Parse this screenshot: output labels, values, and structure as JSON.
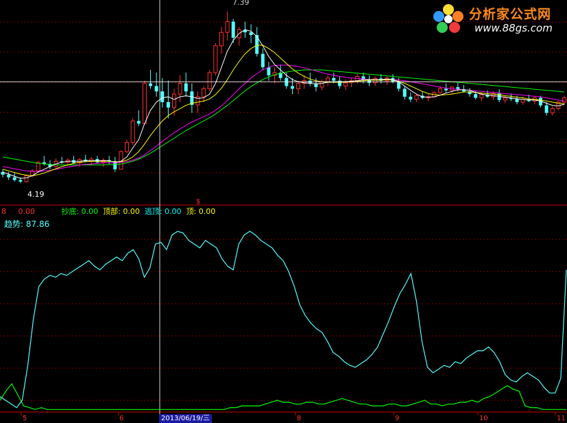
{
  "logo": {
    "title": "分析家公式网",
    "url": "www.88gs.com"
  },
  "price_panel": {
    "high_label": "7.39",
    "low_label": "4.19",
    "indicator_line": [
      {
        "text": "8",
        "color": "#ff3030"
      },
      {
        "text": "0.00",
        "color": "#ff3030"
      },
      {
        "text": "抄底: 0.00",
        "color": "#00ff00"
      },
      {
        "text": "顶部: 0.00",
        "color": "#ffff00"
      },
      {
        "text": "逃顶: 0.00",
        "color": "#00ffff"
      },
      {
        "text": "顶: 0.00",
        "color": "#ffff00"
      }
    ]
  },
  "indicator_panel": {
    "title": "趋势: 87.86"
  },
  "time_axis": {
    "ticks": [
      "5",
      "6",
      "8",
      "9",
      "10",
      "11"
    ],
    "cursor_date": "2013/06/19/三"
  },
  "colors": {
    "background": "#000000",
    "up_candle": "#ff3030",
    "down_candle": "#54ffff",
    "ma_short": "#ffffff",
    "ma_mid": "#ffff00",
    "ma_long": "#ff00ff",
    "ma_longest": "#00ff00",
    "trend_line": "#54ffff",
    "secondary_line": "#00ff00",
    "grid": "#7a0000"
  },
  "chart_data": [
    {
      "type": "candlestick",
      "title": "",
      "ylim": [
        3.9,
        7.5
      ],
      "price_levels": {
        "high": 7.39,
        "low": 4.19,
        "crosshair": 6.08
      },
      "candles_ohlc": [
        [
          4.4,
          4.45,
          4.3,
          4.35
        ],
        [
          4.35,
          4.4,
          4.25,
          4.3
        ],
        [
          4.3,
          4.38,
          4.22,
          4.25
        ],
        [
          4.25,
          4.3,
          4.19,
          4.22
        ],
        [
          4.22,
          4.35,
          4.2,
          4.33
        ],
        [
          4.33,
          4.45,
          4.3,
          4.42
        ],
        [
          4.42,
          4.6,
          4.4,
          4.58
        ],
        [
          4.58,
          4.7,
          4.52,
          4.55
        ],
        [
          4.55,
          4.62,
          4.45,
          4.5
        ],
        [
          4.5,
          4.65,
          4.48,
          4.6
        ],
        [
          4.6,
          4.68,
          4.55,
          4.58
        ],
        [
          4.58,
          4.66,
          4.52,
          4.62
        ],
        [
          4.62,
          4.7,
          4.55,
          4.57
        ],
        [
          4.57,
          4.66,
          4.5,
          4.63
        ],
        [
          4.63,
          4.72,
          4.58,
          4.6
        ],
        [
          4.6,
          4.68,
          4.52,
          4.64
        ],
        [
          4.64,
          4.7,
          4.55,
          4.58
        ],
        [
          4.58,
          4.66,
          4.5,
          4.62
        ],
        [
          4.62,
          4.7,
          4.55,
          4.6
        ],
        [
          4.6,
          4.68,
          4.4,
          4.45
        ],
        [
          4.45,
          4.8,
          4.45,
          4.78
        ],
        [
          4.78,
          5.0,
          4.75,
          4.95
        ],
        [
          4.95,
          5.4,
          4.9,
          5.35
        ],
        [
          5.35,
          5.55,
          5.25,
          5.3
        ],
        [
          5.3,
          6.1,
          5.3,
          6.05
        ],
        [
          6.05,
          6.3,
          5.95,
          6.0
        ],
        [
          6.0,
          6.25,
          5.8,
          5.9
        ],
        [
          5.9,
          6.15,
          5.6,
          5.7
        ],
        [
          5.7,
          6.1,
          5.4,
          5.6
        ],
        [
          5.6,
          5.95,
          5.45,
          5.85
        ],
        [
          5.85,
          6.2,
          5.7,
          6.05
        ],
        [
          6.05,
          6.25,
          5.8,
          5.9
        ],
        [
          5.9,
          6.05,
          5.5,
          5.65
        ],
        [
          5.65,
          5.9,
          5.5,
          5.8
        ],
        [
          5.8,
          6.0,
          5.7,
          5.95
        ],
        [
          5.95,
          6.3,
          5.9,
          6.25
        ],
        [
          6.25,
          6.8,
          6.2,
          6.75
        ],
        [
          6.75,
          7.1,
          6.6,
          7.0
        ],
        [
          7.0,
          7.39,
          6.85,
          7.2
        ],
        [
          7.2,
          7.25,
          6.8,
          6.9
        ],
        [
          6.9,
          7.1,
          6.75,
          7.05
        ],
        [
          7.05,
          7.2,
          6.9,
          7.0
        ],
        [
          7.0,
          7.15,
          6.8,
          6.95
        ],
        [
          6.95,
          7.1,
          6.55,
          6.6
        ],
        [
          6.6,
          6.7,
          6.3,
          6.35
        ],
        [
          6.35,
          6.45,
          6.1,
          6.2
        ],
        [
          6.2,
          6.35,
          6.05,
          6.25
        ],
        [
          6.25,
          6.4,
          6.1,
          6.15
        ],
        [
          6.15,
          6.25,
          5.95,
          6.0
        ],
        [
          6.0,
          6.15,
          5.85,
          5.95
        ],
        [
          5.95,
          6.1,
          5.85,
          6.05
        ],
        [
          6.05,
          6.2,
          5.95,
          6.1
        ],
        [
          6.1,
          6.25,
          6.0,
          6.05
        ],
        [
          6.05,
          6.15,
          5.9,
          5.98
        ],
        [
          5.98,
          6.12,
          5.92,
          6.08
        ],
        [
          6.08,
          6.2,
          6.0,
          6.15
        ],
        [
          6.15,
          6.25,
          6.05,
          6.1
        ],
        [
          6.1,
          6.18,
          5.95,
          6.0
        ],
        [
          6.0,
          6.12,
          5.92,
          6.06
        ],
        [
          6.06,
          6.15,
          5.98,
          6.1
        ],
        [
          6.1,
          6.22,
          6.05,
          6.18
        ],
        [
          6.18,
          6.25,
          6.05,
          6.12
        ],
        [
          6.12,
          6.2,
          6.0,
          6.06
        ],
        [
          6.06,
          6.18,
          6.0,
          6.14
        ],
        [
          6.14,
          6.22,
          6.05,
          6.1
        ],
        [
          6.1,
          6.18,
          6.02,
          6.15
        ],
        [
          6.15,
          6.22,
          6.05,
          6.08
        ],
        [
          6.08,
          6.15,
          5.9,
          5.95
        ],
        [
          5.95,
          6.0,
          5.75,
          5.8
        ],
        [
          5.8,
          5.88,
          5.7,
          5.75
        ],
        [
          5.75,
          5.85,
          5.7,
          5.82
        ],
        [
          5.82,
          5.9,
          5.75,
          5.78
        ],
        [
          5.78,
          5.85,
          5.72,
          5.8
        ],
        [
          5.8,
          5.9,
          5.78,
          5.88
        ],
        [
          5.88,
          6.0,
          5.85,
          5.95
        ],
        [
          5.95,
          6.05,
          5.88,
          5.92
        ],
        [
          5.92,
          6.0,
          5.85,
          5.98
        ],
        [
          5.98,
          6.06,
          5.9,
          5.94
        ],
        [
          5.94,
          6.02,
          5.88,
          5.9
        ],
        [
          5.9,
          5.96,
          5.8,
          5.85
        ],
        [
          5.85,
          5.92,
          5.75,
          5.78
        ],
        [
          5.78,
          5.88,
          5.72,
          5.84
        ],
        [
          5.84,
          5.92,
          5.78,
          5.8
        ],
        [
          5.8,
          5.9,
          5.74,
          5.86
        ],
        [
          5.86,
          5.94,
          5.7,
          5.74
        ],
        [
          5.74,
          5.82,
          5.68,
          5.78
        ],
        [
          5.78,
          5.86,
          5.72,
          5.76
        ],
        [
          5.76,
          5.82,
          5.66,
          5.7
        ],
        [
          5.7,
          5.8,
          5.65,
          5.75
        ],
        [
          5.75,
          5.84,
          5.7,
          5.72
        ],
        [
          5.72,
          5.8,
          5.66,
          5.78
        ],
        [
          5.78,
          5.82,
          5.6,
          5.64
        ],
        [
          5.64,
          5.7,
          5.45,
          5.5
        ],
        [
          5.5,
          5.62,
          5.45,
          5.58
        ],
        [
          5.58,
          5.72,
          5.55,
          5.7
        ],
        [
          5.7,
          5.82,
          5.65,
          5.78
        ]
      ],
      "ma_short": [
        4.4,
        4.36,
        4.32,
        4.28,
        4.29,
        4.33,
        4.4,
        4.45,
        4.5,
        4.55,
        4.58,
        4.6,
        4.6,
        4.6,
        4.61,
        4.61,
        4.61,
        4.61,
        4.61,
        4.58,
        4.6,
        4.68,
        4.85,
        5.0,
        5.3,
        5.55,
        5.7,
        5.78,
        5.8,
        5.75,
        5.8,
        5.82,
        5.8,
        5.77,
        5.78,
        5.85,
        6.05,
        6.35,
        6.65,
        6.85,
        6.98,
        7.05,
        7.02,
        6.92,
        6.75,
        6.55,
        6.4,
        6.3,
        6.2,
        6.12,
        6.08,
        6.06,
        6.05,
        6.04,
        6.05,
        6.07,
        6.08,
        6.08,
        6.08,
        6.09,
        6.1,
        6.12,
        6.12,
        6.12,
        6.12,
        6.13,
        6.12,
        6.08,
        6.0,
        5.92,
        5.85,
        5.8,
        5.79,
        5.8,
        5.83,
        5.87,
        5.9,
        5.93,
        5.93,
        5.92,
        5.88,
        5.85,
        5.83,
        5.82,
        5.81,
        5.79,
        5.78,
        5.76,
        5.75,
        5.74,
        5.74,
        5.72,
        5.68,
        5.64,
        5.63,
        5.66
      ],
      "ma_mid": [
        4.45,
        4.42,
        4.39,
        4.36,
        4.34,
        4.33,
        4.35,
        4.38,
        4.42,
        4.46,
        4.5,
        4.53,
        4.56,
        4.58,
        4.59,
        4.6,
        4.6,
        4.6,
        4.6,
        4.59,
        4.59,
        4.62,
        4.68,
        4.78,
        4.92,
        5.08,
        5.22,
        5.35,
        5.45,
        5.52,
        5.58,
        5.64,
        5.68,
        5.7,
        5.72,
        5.76,
        5.84,
        5.96,
        6.12,
        6.3,
        6.46,
        6.6,
        6.7,
        6.76,
        6.76,
        6.7,
        6.62,
        6.52,
        6.42,
        6.32,
        6.24,
        6.18,
        6.13,
        6.1,
        6.08,
        6.07,
        6.07,
        6.07,
        6.07,
        6.08,
        6.09,
        6.1,
        6.11,
        6.11,
        6.11,
        6.12,
        6.11,
        6.09,
        6.05,
        6.0,
        5.95,
        5.9,
        5.86,
        5.84,
        5.83,
        5.84,
        5.85,
        5.87,
        5.89,
        5.89,
        5.88,
        5.87,
        5.86,
        5.85,
        5.84,
        5.82,
        5.81,
        5.79,
        5.78,
        5.76,
        5.75,
        5.74,
        5.72,
        5.7,
        5.68,
        5.67
      ],
      "ma_long": [
        4.5,
        4.48,
        4.46,
        4.44,
        4.42,
        4.41,
        4.41,
        4.42,
        4.43,
        4.45,
        4.47,
        4.49,
        4.51,
        4.53,
        4.54,
        4.55,
        4.56,
        4.57,
        4.57,
        4.57,
        4.58,
        4.59,
        4.62,
        4.66,
        4.72,
        4.8,
        4.88,
        4.97,
        5.05,
        5.13,
        5.2,
        5.27,
        5.33,
        5.38,
        5.43,
        5.48,
        5.55,
        5.63,
        5.73,
        5.84,
        5.95,
        6.05,
        6.15,
        6.23,
        6.3,
        6.35,
        6.38,
        6.39,
        6.39,
        6.38,
        6.36,
        6.34,
        6.31,
        6.28,
        6.25,
        6.22,
        6.2,
        6.18,
        6.16,
        6.15,
        6.14,
        6.13,
        6.12,
        6.12,
        6.12,
        6.12,
        6.12,
        6.11,
        6.1,
        6.08,
        6.06,
        6.04,
        6.02,
        6.0,
        5.98,
        5.96,
        5.95,
        5.94,
        5.93,
        5.92,
        5.91,
        5.9,
        5.89,
        5.88,
        5.87,
        5.86,
        5.85,
        5.84,
        5.83,
        5.82,
        5.81,
        5.8,
        5.78,
        5.76,
        5.74,
        5.72
      ],
      "ma_longest": [
        4.68,
        4.66,
        4.64,
        4.62,
        4.6,
        4.58,
        4.56,
        4.55,
        4.54,
        4.53,
        4.53,
        4.53,
        4.53,
        4.53,
        4.53,
        4.53,
        4.53,
        4.53,
        4.54,
        4.54,
        4.55,
        4.57,
        4.6,
        4.64,
        4.69,
        4.75,
        4.82,
        4.89,
        4.96,
        5.03,
        5.1,
        5.17,
        5.23,
        5.29,
        5.35,
        5.41,
        5.48,
        5.56,
        5.64,
        5.73,
        5.82,
        5.91,
        5.99,
        6.06,
        6.12,
        6.17,
        6.21,
        6.24,
        6.26,
        6.28,
        6.29,
        6.3,
        6.3,
        6.3,
        6.3,
        6.29,
        6.28,
        6.27,
        6.26,
        6.25,
        6.24,
        6.23,
        6.22,
        6.21,
        6.2,
        6.19,
        6.18,
        6.17,
        6.16,
        6.15,
        6.14,
        6.13,
        6.12,
        6.11,
        6.1,
        6.09,
        6.08,
        6.07,
        6.06,
        6.05,
        6.04,
        6.03,
        6.02,
        6.01,
        6.0,
        5.99,
        5.98,
        5.97,
        5.96,
        5.95,
        5.94,
        5.93,
        5.92,
        5.91,
        5.9,
        5.89
      ]
    },
    {
      "type": "line",
      "title": "趋势: 87.86",
      "ylim": [
        0,
        100
      ],
      "series": [
        {
          "name": "趋势",
          "values": [
            8,
            6,
            4,
            2,
            6,
            25,
            50,
            68,
            72,
            74,
            73,
            75,
            74,
            76,
            78,
            80,
            82,
            79,
            77,
            80,
            82,
            84,
            82,
            86,
            88,
            83,
            73,
            78,
            91,
            92,
            88,
            96,
            98,
            97,
            93,
            91,
            89,
            93,
            91,
            89,
            83,
            79,
            77,
            91,
            96,
            98,
            96,
            93,
            91,
            89,
            85,
            82,
            76,
            68,
            58,
            52,
            48,
            45,
            43,
            38,
            32,
            30,
            27,
            25,
            24,
            26,
            28,
            31,
            35,
            42,
            49,
            57,
            64,
            69,
            75,
            60,
            38,
            24,
            21,
            23,
            25,
            24,
            27,
            26,
            29,
            31,
            33,
            33,
            35,
            32,
            27,
            20,
            17,
            16,
            19,
            21,
            19,
            17,
            13,
            10,
            10,
            18,
            77
          ]
        },
        {
          "values": [
            6,
            11,
            15,
            9,
            3,
            2,
            1,
            2,
            1,
            1,
            1,
            1,
            1,
            1,
            1,
            1,
            1,
            1,
            1,
            1,
            1,
            1,
            1,
            1,
            1,
            1,
            1,
            1,
            1,
            1,
            1,
            1,
            1,
            1,
            1,
            1,
            1,
            1,
            1,
            2,
            2,
            3,
            3,
            3,
            3,
            4,
            5,
            6,
            5,
            5,
            4,
            4,
            5,
            5,
            4,
            4,
            5,
            6,
            7,
            6,
            5,
            4,
            4,
            3,
            3,
            3,
            4,
            4,
            3,
            3,
            4,
            5,
            6,
            4,
            4,
            3,
            4,
            4,
            5,
            5,
            6,
            5,
            7,
            8,
            10,
            12,
            14,
            12,
            11,
            3,
            2,
            2,
            1,
            1,
            1,
            1,
            1
          ]
        }
      ]
    }
  ]
}
